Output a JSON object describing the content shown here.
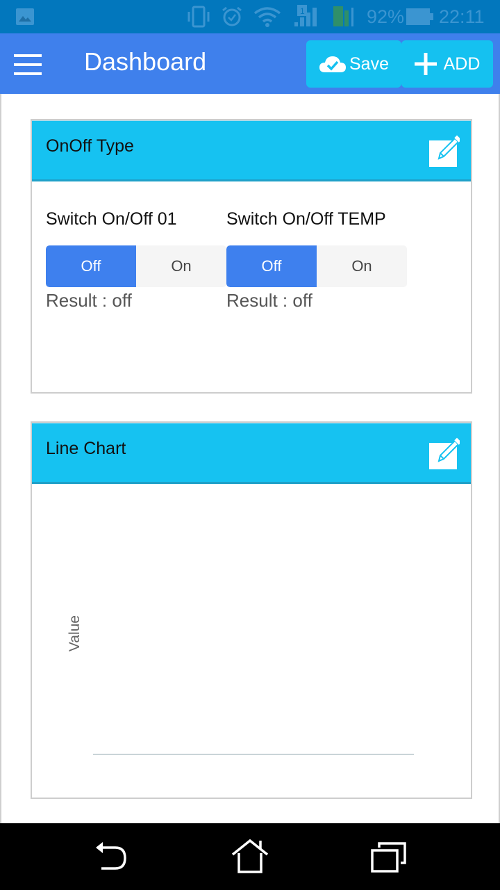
{
  "status_bar": {
    "battery": "92%",
    "time": "22:11",
    "sim_label": "1",
    "icons": [
      "gallery-icon",
      "vibrate-icon",
      "alarm-icon",
      "wifi-icon",
      "signal-sim1-icon",
      "signal-sim2-icon",
      "battery-icon"
    ]
  },
  "app_bar": {
    "title": "Dashboard",
    "menu_icon": "hamburger-icon",
    "save_label": "Save",
    "save_icon": "cloud-check-icon",
    "add_label": "ADD",
    "add_icon": "plus-icon"
  },
  "colors": {
    "status_bar": "#0277bd",
    "app_bar": "#3f80ec",
    "toolbar_button": "#15c1f0",
    "card_header": "#16c2f1",
    "segment_active": "#3e80ee"
  },
  "cards": [
    {
      "title": "OnOff Type",
      "edit_icon": "edit-icon",
      "switches": [
        {
          "label": "Switch On/Off 01",
          "options": [
            "Off",
            "On"
          ],
          "selected": "Off",
          "result": "Result : off"
        },
        {
          "label": "Switch On/Off TEMP",
          "options": [
            "Off",
            "On"
          ],
          "selected": "Off",
          "result": "Result : off"
        }
      ]
    },
    {
      "title": "Line Chart",
      "edit_icon": "edit-icon"
    }
  ],
  "chart_data": {
    "type": "line",
    "title": "",
    "xlabel": "",
    "ylabel": "Value",
    "series": [],
    "x": [],
    "grid": false,
    "legend": "none"
  },
  "nav_bar": {
    "buttons": [
      "back-icon",
      "home-icon",
      "recent-apps-icon"
    ]
  }
}
